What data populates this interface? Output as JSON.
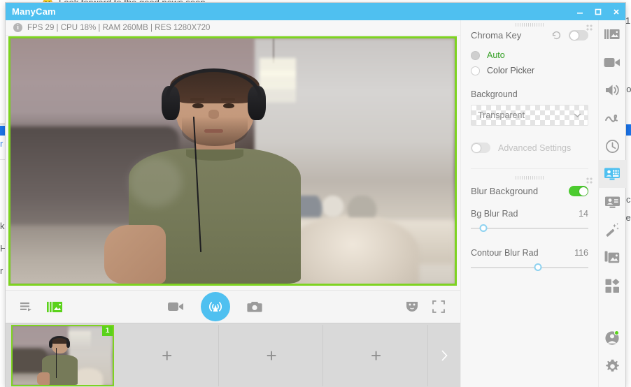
{
  "desktop": {
    "bg_line_1": "Look forward to the good news soon",
    "bg_emoji": "😊",
    "bg_right_1": "go",
    "bg_right_2": "| c",
    "bg_right_3": "se",
    "bg_right_4": "e",
    "bg_right_5": "1",
    "bg_left_1": "r",
    "bg_left_2": "k",
    "bg_left_3": "H"
  },
  "window": {
    "title": "ManyCam",
    "controls": {
      "minimize": "minimize-button",
      "maximize": "maximize-button",
      "close": "close-button"
    }
  },
  "infobar": {
    "icon": "info-icon",
    "text": "FPS 29 | CPU 18% | RAM 260MB | RES 1280X720"
  },
  "controlbar": {
    "playlist_label": "playlist-icon",
    "slides_label": "slides-icon",
    "record_label": "record-icon",
    "broadcast_label": "broadcast-icon",
    "snapshot_label": "snapshot-icon",
    "mask_label": "mask-icon",
    "fullscreen_label": "fullscreen-icon"
  },
  "thumbstrip": {
    "active_badge": "1",
    "add_label": "+",
    "next_label": "›"
  },
  "panel": {
    "chroma": {
      "title": "Chroma Key",
      "enabled": false,
      "reset": "reset-icon",
      "modes": [
        {
          "label": "Auto",
          "selected": true
        },
        {
          "label": "Color Picker",
          "selected": false
        }
      ],
      "background_label": "Background",
      "background_value": "Transparent",
      "advanced_label": "Advanced Settings",
      "advanced_enabled": false
    },
    "blur": {
      "title": "Blur Background",
      "enabled": true,
      "sliders": [
        {
          "name": "Bg Blur Rad",
          "value": "14",
          "percent": 11
        },
        {
          "name": "Contour Blur Rad",
          "value": "116",
          "percent": 57
        }
      ]
    }
  },
  "rail": {
    "items": [
      {
        "name": "effects-icon",
        "active": false
      },
      {
        "name": "video-sources-icon",
        "active": false
      },
      {
        "name": "audio-icon",
        "active": false
      },
      {
        "name": "draw-icon",
        "active": false
      },
      {
        "name": "history-icon",
        "active": false
      },
      {
        "name": "background-icon",
        "active": true
      },
      {
        "name": "presenter-icon",
        "active": false
      },
      {
        "name": "magic-wand-icon",
        "active": false
      },
      {
        "name": "gallery-icon",
        "active": false
      },
      {
        "name": "apps-icon",
        "active": false
      }
    ],
    "account": "account-icon",
    "settings": "settings-icon"
  },
  "colors": {
    "title_blue": "#4fc0f0",
    "accent_green": "#7ed321",
    "toggle_green": "#4ccb2f",
    "slider_blue": "#8ed2f0"
  }
}
